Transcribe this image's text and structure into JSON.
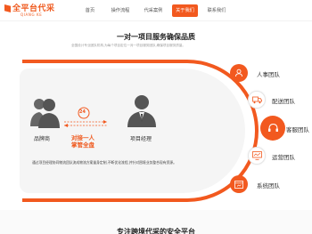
{
  "logo": {
    "title": "全平台代采",
    "subtitle": "QIANG KE"
  },
  "nav": {
    "items": [
      {
        "label": "首页"
      },
      {
        "label": "操作流程"
      },
      {
        "label": "代采案例"
      },
      {
        "label": "关于我们",
        "active": true
      },
      {
        "label": "联系我们"
      }
    ]
  },
  "section": {
    "title": "一对一项目服务确保品质",
    "subtitle": "全国设计专业团队机构,为每个项目定位一对一项目服务团队,确保项目服务质量。"
  },
  "relation": {
    "left_label": "品牌商",
    "right_label": "项目经理",
    "badge": "24",
    "mid_line1": "对接一人",
    "mid_line2": "掌管全盘"
  },
  "teams": [
    {
      "label": "人事团队",
      "icon": "user-team-icon"
    },
    {
      "label": "配送团队",
      "icon": "truck-icon"
    },
    {
      "label": "客服团队",
      "icon": "headset-icon"
    },
    {
      "label": "运营团队",
      "icon": "monitor-icon"
    },
    {
      "label": "系统团队",
      "icon": "system-window-icon"
    }
  ],
  "description": "通过项目经理协同物流团队流成物流方案量身定制,不断优化流程,并针对困境业务整合现有资源。",
  "footer": {
    "title": "专注跨境代采的安全平台"
  },
  "colors": {
    "accent": "#f2591f",
    "text": "#333333"
  }
}
